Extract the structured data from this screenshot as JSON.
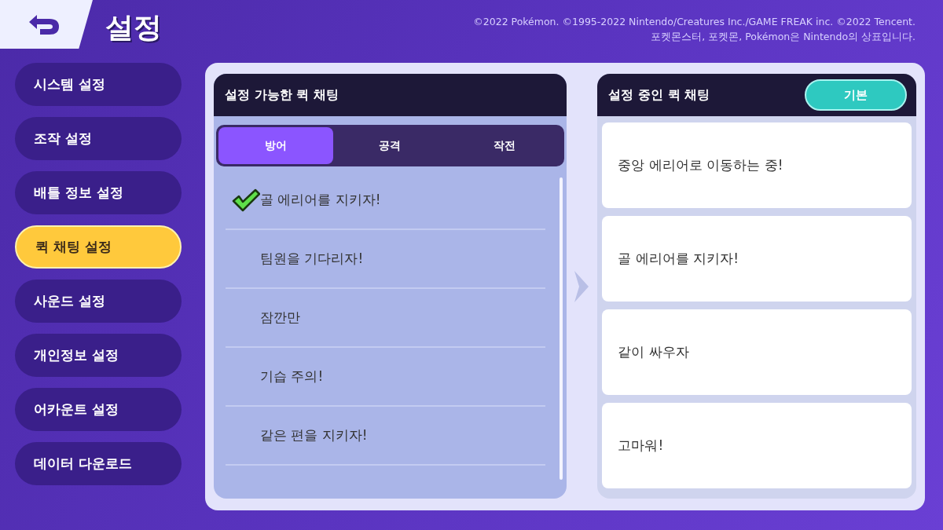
{
  "header": {
    "title": "설정",
    "copyright": [
      "©2022 Pokémon. ©1995-2022 Nintendo/Creatures Inc./GAME FREAK inc. ©2022 Tencent.",
      "포켓몬스터, 포켓몬, Pokémon은 Nintendo의 상표입니다."
    ]
  },
  "sidebar": {
    "items": [
      {
        "label": "시스템 설정",
        "selected": false
      },
      {
        "label": "조작 설정",
        "selected": false
      },
      {
        "label": "배틀 정보 설정",
        "selected": false
      },
      {
        "label": "퀵 채팅 설정",
        "selected": true
      },
      {
        "label": "사운드 설정",
        "selected": false
      },
      {
        "label": "개인정보 설정",
        "selected": false
      },
      {
        "label": "어카운트 설정",
        "selected": false
      },
      {
        "label": "데이터 다운로드",
        "selected": false
      }
    ]
  },
  "available": {
    "title": "설정 가능한 퀵 채팅",
    "tabs": [
      {
        "label": "방어",
        "selected": true
      },
      {
        "label": "공격",
        "selected": false
      },
      {
        "label": "작전",
        "selected": false
      }
    ],
    "items": [
      {
        "label": "골 에리어를 지키자!",
        "checked": true
      },
      {
        "label": "팀원을 기다리자!",
        "checked": false
      },
      {
        "label": "잠깐만",
        "checked": false
      },
      {
        "label": "기습 주의!",
        "checked": false
      },
      {
        "label": "같은 편을 지키자!",
        "checked": false
      }
    ]
  },
  "current": {
    "title": "설정 중인 퀵 채팅",
    "button": "기본",
    "items": [
      "중앙 에리어로 이동하는 중!",
      "골 에리어를 지키자!",
      "같이 싸우자",
      "고마워!"
    ]
  }
}
